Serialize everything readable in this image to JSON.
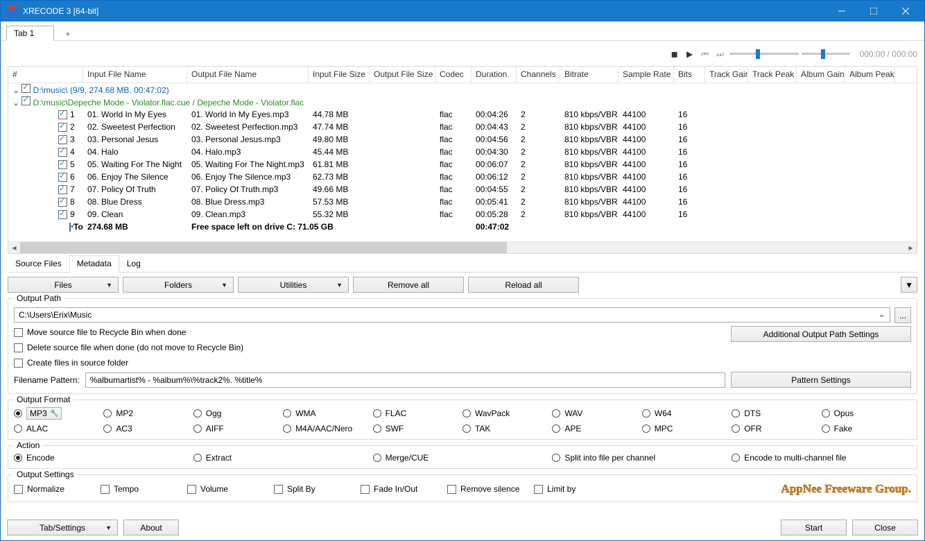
{
  "window": {
    "title": "XRECODE 3 [64-bit]"
  },
  "tab": {
    "label": "Tab 1"
  },
  "time": {
    "cur": "000:00",
    "tot": "000:00"
  },
  "headers": [
    "#",
    "Input File Name",
    "Output File Name",
    "Input File Size",
    "Output File Size",
    "Codec",
    "Duration",
    "Channels",
    "Bitrate",
    "Sample Rate",
    "Bits",
    "Track Gain",
    "Track Peak",
    "Album Gain",
    "Album Peak"
  ],
  "folder_line": "D:\\music\\ (9/9, 274.68 MB, 00:47:02)",
  "cue_line": "D:\\music\\Depeche Mode - Violator.flac.cue / Depeche Mode - Violator.flac",
  "tracks": [
    {
      "n": "1",
      "in": "01. World In My Eyes",
      "out": "01. World In My Eyes.mp3",
      "isize": "44.78 MB",
      "codec": "flac",
      "dur": "00:04:26",
      "ch": "2",
      "bit": "810 kbps/VBR",
      "sr": "44100",
      "bits": "16"
    },
    {
      "n": "2",
      "in": "02. Sweetest Perfection",
      "out": "02. Sweetest Perfection.mp3",
      "isize": "47.74 MB",
      "codec": "flac",
      "dur": "00:04:43",
      "ch": "2",
      "bit": "810 kbps/VBR",
      "sr": "44100",
      "bits": "16"
    },
    {
      "n": "3",
      "in": "03. Personal Jesus",
      "out": "03. Personal Jesus.mp3",
      "isize": "49.80 MB",
      "codec": "flac",
      "dur": "00:04:56",
      "ch": "2",
      "bit": "810 kbps/VBR",
      "sr": "44100",
      "bits": "16"
    },
    {
      "n": "4",
      "in": "04. Halo",
      "out": "04. Halo.mp3",
      "isize": "45.44 MB",
      "codec": "flac",
      "dur": "00:04:30",
      "ch": "2",
      "bit": "810 kbps/VBR",
      "sr": "44100",
      "bits": "16"
    },
    {
      "n": "5",
      "in": "05. Waiting For The Night",
      "out": "05. Waiting For The Night.mp3",
      "isize": "61.81 MB",
      "codec": "flac",
      "dur": "00:06:07",
      "ch": "2",
      "bit": "810 kbps/VBR",
      "sr": "44100",
      "bits": "16"
    },
    {
      "n": "6",
      "in": "06. Enjoy The Silence",
      "out": "06. Enjoy The Silence.mp3",
      "isize": "62.73 MB",
      "codec": "flac",
      "dur": "00:06:12",
      "ch": "2",
      "bit": "810 kbps/VBR",
      "sr": "44100",
      "bits": "16"
    },
    {
      "n": "7",
      "in": "07. Policy Of Truth",
      "out": "07. Policy Of Truth.mp3",
      "isize": "49.66 MB",
      "codec": "flac",
      "dur": "00:04:55",
      "ch": "2",
      "bit": "810 kbps/VBR",
      "sr": "44100",
      "bits": "16"
    },
    {
      "n": "8",
      "in": "08. Blue Dress",
      "out": "08. Blue Dress.mp3",
      "isize": "57.53 MB",
      "codec": "flac",
      "dur": "00:05:41",
      "ch": "2",
      "bit": "810 kbps/VBR",
      "sr": "44100",
      "bits": "16"
    },
    {
      "n": "9",
      "in": "09. Clean",
      "out": "09. Clean.mp3",
      "isize": "55.32 MB",
      "codec": "flac",
      "dur": "00:05:28",
      "ch": "2",
      "bit": "810 kbps/VBR",
      "sr": "44100",
      "bits": "16"
    }
  ],
  "total": {
    "label": "Total:",
    "size": "274.68 MB",
    "free": "Free space left on drive C: 71.05 GB",
    "dur": "00:47:02"
  },
  "subtabs": {
    "source": "Source Files",
    "meta": "Metadata",
    "log": "Log"
  },
  "toolbar": {
    "files": "Files",
    "folders": "Folders",
    "utilities": "Utilities",
    "removeall": "Remove all",
    "reloadall": "Reload all"
  },
  "outpath": {
    "legend": "Output Path",
    "value": "C:\\Users\\Erix\\Music",
    "browse": "...",
    "moverec": "Move source file to Recycle Bin when done",
    "delsrc": "Delete source file when done (do not move to Recycle Bin)",
    "createsrc": "Create files in source folder",
    "addl": "Additional Output Path Settings",
    "patlabel": "Filename Pattern:",
    "patval": "%albumartist% - %album%\\%track2%. %title%",
    "patbtn": "Pattern Settings"
  },
  "fmt": {
    "legend": "Output Format",
    "row1": [
      "MP3",
      "MP2",
      "Ogg",
      "WMA",
      "FLAC",
      "WavPack",
      "WAV",
      "W64",
      "DTS",
      "Opus"
    ],
    "row2": [
      "ALAC",
      "AC3",
      "AIFF",
      "M4A/AAC/Nero",
      "SWF",
      "TAK",
      "APE",
      "MPC",
      "OFR",
      "Fake"
    ]
  },
  "action": {
    "legend": "Action",
    "opts": [
      "Encode",
      "Extract",
      "Merge/CUE",
      "Split into file per channel",
      "Encode to multi-channel file"
    ]
  },
  "outset": {
    "legend": "Output Settings",
    "opts": [
      "Normalize",
      "Tempo",
      "Volume",
      "Split By",
      "Fade In/Out",
      "Remove silence",
      "Limit by"
    ],
    "watermark": "AppNee Freeware Group."
  },
  "footer": {
    "tabset": "Tab/Settings",
    "about": "About",
    "start": "Start",
    "close": "Close"
  }
}
